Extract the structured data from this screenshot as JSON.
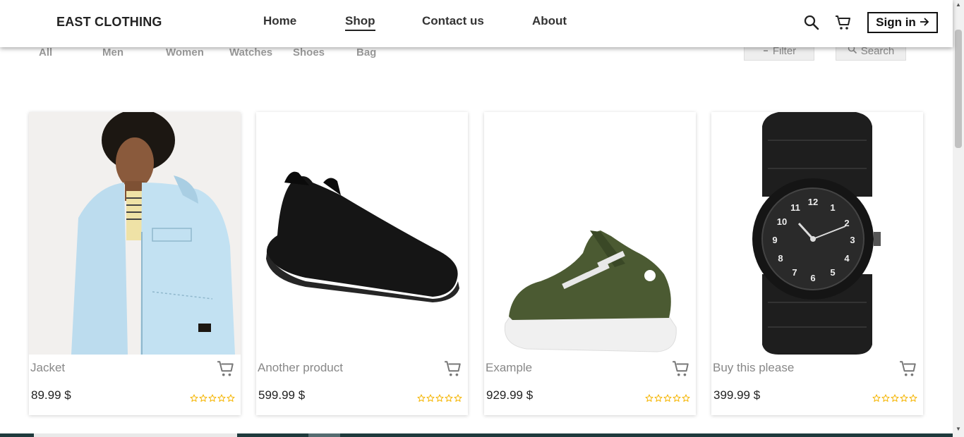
{
  "brand": "EAST CLOTHING",
  "nav": {
    "home": "Home",
    "shop": "Shop",
    "contact": "Contact us",
    "about": "About"
  },
  "header_actions": {
    "search_icon": "search-icon",
    "cart_icon": "cart-icon",
    "signin_label": "Sign in"
  },
  "categories": [
    "All",
    "Men",
    "Women",
    "Watches",
    "Shoes",
    "Bag"
  ],
  "tools": {
    "filter_label": "Filter",
    "search_label": "Search"
  },
  "products": [
    {
      "name": "Jacket",
      "price": "89.99 $",
      "rating": 0,
      "max_rating": 5
    },
    {
      "name": "Another product",
      "price": "599.99 $",
      "rating": 0,
      "max_rating": 5
    },
    {
      "name": "Example",
      "price": "929.99 $",
      "rating": 0,
      "max_rating": 5
    },
    {
      "name": "Buy this please",
      "price": "399.99 $",
      "rating": 0,
      "max_rating": 5
    }
  ],
  "colors": {
    "star": "#f5b400",
    "text_dark": "#222222",
    "text_muted": "#888888"
  }
}
